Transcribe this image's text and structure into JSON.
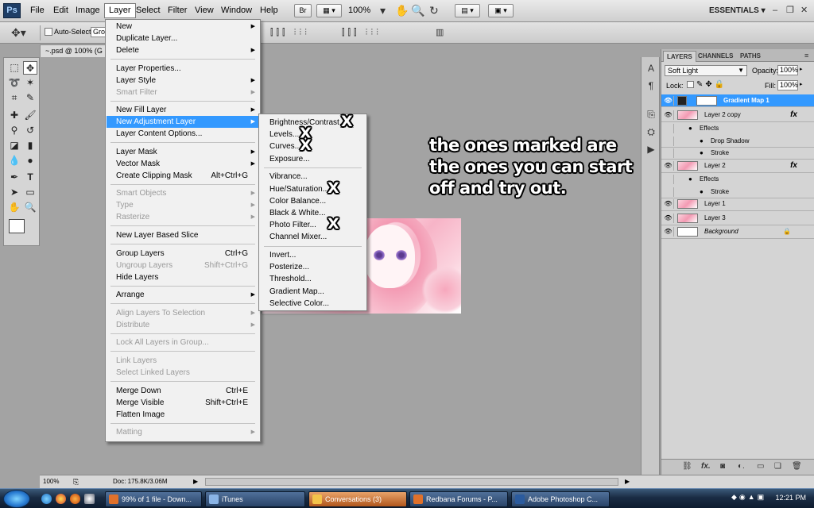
{
  "menubar": {
    "logo": "Ps",
    "items": [
      "File",
      "Edit",
      "Image",
      "Layer",
      "Select",
      "Filter",
      "View",
      "Window",
      "Help"
    ],
    "active_item": "Layer",
    "bridge_label": "Br",
    "zoom": "100%",
    "workspace": "ESSENTIALS ▾"
  },
  "options": {
    "auto_select_label": "Auto-Select:",
    "auto_select_value": "Gro"
  },
  "document": {
    "tab_title": "~.psd @ 100% (G"
  },
  "layer_menu": [
    {
      "label": "New",
      "submenu": true
    },
    {
      "label": "Duplicate Layer..."
    },
    {
      "label": "Delete",
      "submenu": true
    },
    {
      "sep": true
    },
    {
      "label": "Layer Properties..."
    },
    {
      "label": "Layer Style",
      "submenu": true
    },
    {
      "label": "Smart Filter",
      "disabled": true,
      "submenu": true
    },
    {
      "sep": true
    },
    {
      "label": "New Fill Layer",
      "submenu": true
    },
    {
      "label": "New Adjustment Layer",
      "submenu": true,
      "highlighted": true
    },
    {
      "label": "Layer Content Options..."
    },
    {
      "sep": true
    },
    {
      "label": "Layer Mask",
      "submenu": true
    },
    {
      "label": "Vector Mask",
      "submenu": true
    },
    {
      "label": "Create Clipping Mask",
      "shortcut": "Alt+Ctrl+G"
    },
    {
      "sep": true
    },
    {
      "label": "Smart Objects",
      "disabled": true,
      "submenu": true
    },
    {
      "label": "Type",
      "disabled": true,
      "submenu": true
    },
    {
      "label": "Rasterize",
      "disabled": true,
      "submenu": true
    },
    {
      "sep": true
    },
    {
      "label": "New Layer Based Slice"
    },
    {
      "sep": true
    },
    {
      "label": "Group Layers",
      "shortcut": "Ctrl+G"
    },
    {
      "label": "Ungroup Layers",
      "shortcut": "Shift+Ctrl+G",
      "disabled": true
    },
    {
      "label": "Hide Layers"
    },
    {
      "sep": true
    },
    {
      "label": "Arrange",
      "submenu": true
    },
    {
      "sep": true
    },
    {
      "label": "Align Layers To Selection",
      "disabled": true,
      "submenu": true
    },
    {
      "label": "Distribute",
      "disabled": true,
      "submenu": true
    },
    {
      "sep": true
    },
    {
      "label": "Lock All Layers in Group...",
      "disabled": true
    },
    {
      "sep": true
    },
    {
      "label": "Link Layers",
      "disabled": true
    },
    {
      "label": "Select Linked Layers",
      "disabled": true
    },
    {
      "sep": true
    },
    {
      "label": "Merge Down",
      "shortcut": "Ctrl+E"
    },
    {
      "label": "Merge Visible",
      "shortcut": "Shift+Ctrl+E"
    },
    {
      "label": "Flatten Image"
    },
    {
      "sep": true
    },
    {
      "label": "Matting",
      "disabled": true,
      "submenu": true
    }
  ],
  "adjustment_submenu": [
    {
      "label": "Brightness/Contrast...",
      "marked": true
    },
    {
      "label": "Levels...",
      "marked": true
    },
    {
      "label": "Curves...",
      "marked": true
    },
    {
      "label": "Exposure..."
    },
    {
      "sep": true
    },
    {
      "label": "Vibrance..."
    },
    {
      "label": "Hue/Saturation...",
      "marked": true
    },
    {
      "label": "Color Balance..."
    },
    {
      "label": "Black & White..."
    },
    {
      "label": "Photo Filter...",
      "marked": true
    },
    {
      "label": "Channel Mixer..."
    },
    {
      "sep": true
    },
    {
      "label": "Invert..."
    },
    {
      "label": "Posterize..."
    },
    {
      "label": "Threshold..."
    },
    {
      "label": "Gradient Map..."
    },
    {
      "label": "Selective Color..."
    }
  ],
  "annotation": {
    "text": "the ones marked are the ones you can start off and try out.",
    "mark": "X"
  },
  "layers_panel": {
    "tabs": [
      "LAYERS",
      "CHANNELS",
      "PATHS"
    ],
    "blend_mode": "Soft Light",
    "opacity_label": "Opacity:",
    "opacity": "100%",
    "lock_label": "Lock:",
    "fill_label": "Fill:",
    "fill": "100%",
    "layers": [
      {
        "name": "Gradient Map 1",
        "selected": true,
        "kind": "adjustment"
      },
      {
        "name": "Layer 2 copy",
        "fx": "fx",
        "kind": "layer"
      },
      {
        "name": "Effects",
        "kind": "effects"
      },
      {
        "name": "Drop Shadow",
        "kind": "effect"
      },
      {
        "name": "Stroke",
        "kind": "effect"
      },
      {
        "name": "Layer 2",
        "fx": "fx",
        "kind": "layer"
      },
      {
        "name": "Effects",
        "kind": "effects"
      },
      {
        "name": "Stroke",
        "kind": "effect"
      },
      {
        "name": "Layer 1",
        "kind": "layer"
      },
      {
        "name": "Layer 3",
        "kind": "layer"
      },
      {
        "name": "Background",
        "kind": "background"
      }
    ]
  },
  "statusbar": {
    "zoom": "100%",
    "doc": "Doc: 175.8K/3.06M"
  },
  "taskbar": {
    "tasks": [
      {
        "label": "99% of 1 file - Down...",
        "color": "#e0712b"
      },
      {
        "label": "iTunes",
        "color": "#8ab4e6"
      },
      {
        "label": "Conversations (3)",
        "color": "#f3c34a",
        "active": true
      },
      {
        "label": "Redbana Forums - P...",
        "color": "#e0712b"
      },
      {
        "label": "Adobe Photoshop C...",
        "color": "#2b5b9e"
      }
    ],
    "clock": "12:21 PM"
  }
}
